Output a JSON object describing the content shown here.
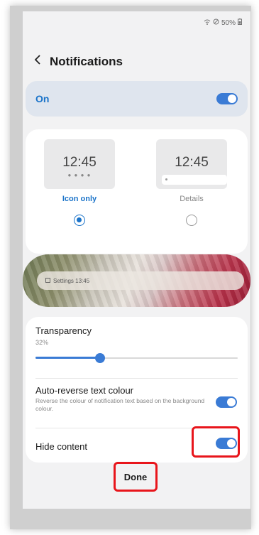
{
  "status": {
    "battery": "50%"
  },
  "header": {
    "title": "Notifications"
  },
  "master": {
    "label": "On",
    "enabled": true
  },
  "styles": {
    "options": [
      {
        "time": "12:45",
        "label": "Icon only",
        "selected": true
      },
      {
        "time": "12:45",
        "label": "Details",
        "selected": false
      }
    ]
  },
  "preview": {
    "notification_text": "Settings 13:45"
  },
  "transparency": {
    "label": "Transparency",
    "value": "32%",
    "level": 0.32
  },
  "auto_reverse": {
    "title": "Auto-reverse text colour",
    "description": "Reverse the colour of notification text based on the background colour.",
    "enabled": true
  },
  "hide_content": {
    "label": "Hide content",
    "enabled": true
  },
  "actions": {
    "done": "Done"
  },
  "colors": {
    "accent": "#3a7bd5",
    "highlight": "#e8151b"
  }
}
